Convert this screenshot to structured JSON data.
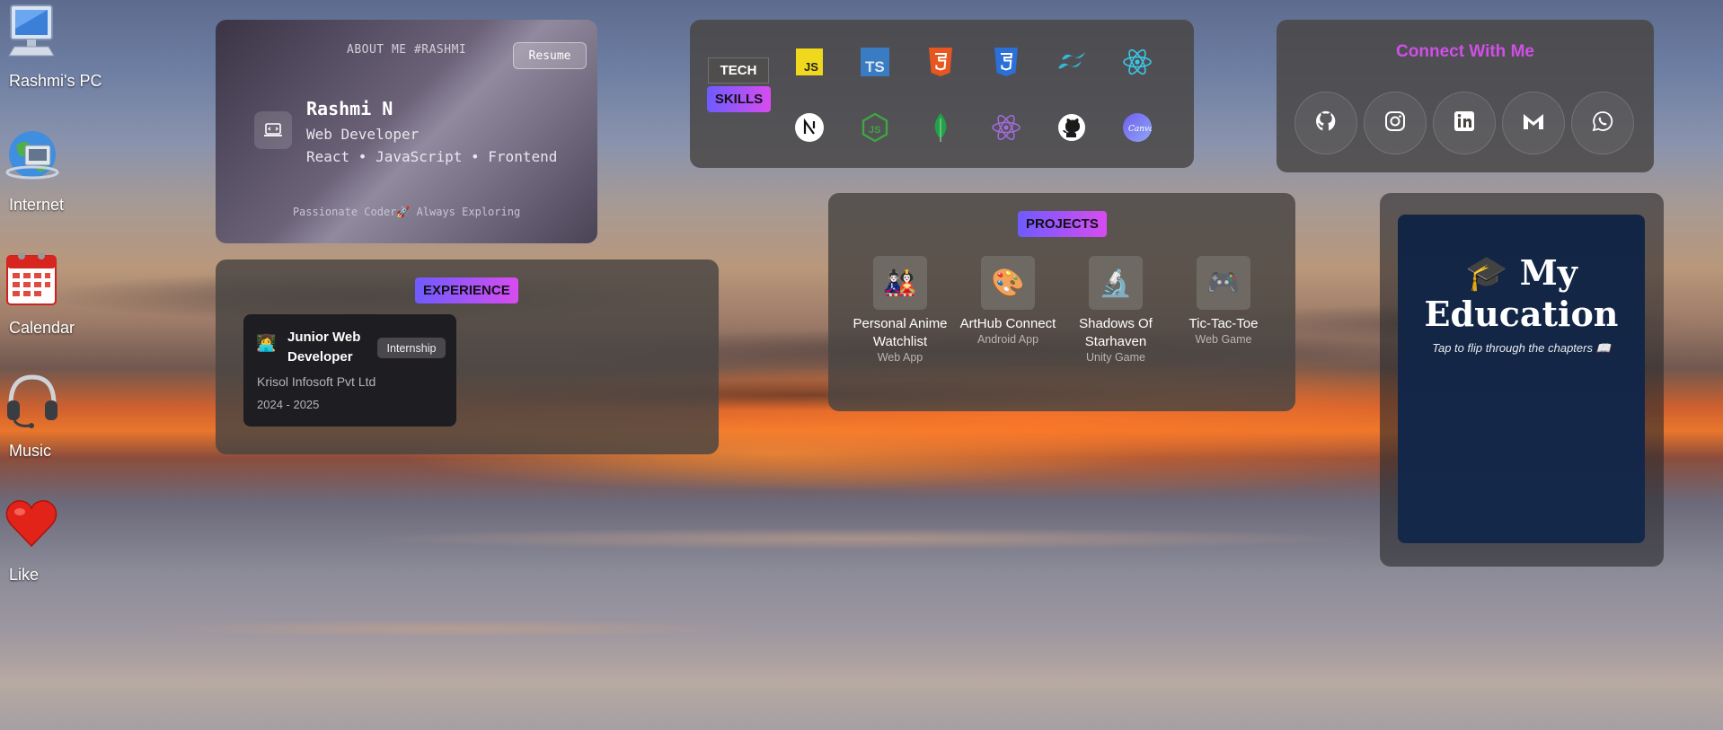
{
  "desktop": {
    "icons": [
      {
        "label": "Rashmi's PC",
        "icon": "computer-icon"
      },
      {
        "label": "Internet",
        "icon": "globe-icon"
      },
      {
        "label": "Calendar",
        "icon": "calendar-icon"
      },
      {
        "label": "Music",
        "icon": "headphones-icon"
      },
      {
        "label": "Like",
        "icon": "heart-icon"
      }
    ]
  },
  "about": {
    "kicker": "ABOUT ME #RASHMI",
    "resume_label": "Resume",
    "name": "Rashmi N",
    "role": "Web Developer",
    "stack": "React • JavaScript • Frontend",
    "tagline": "Passionate Coder🚀 Always Exploring"
  },
  "experience": {
    "heading": "EXPERIENCE",
    "card": {
      "emoji": "👩‍💻",
      "title": "Junior Web Developer",
      "badge": "Internship",
      "company": "Krisol Infosoft Pvt Ltd",
      "dates": "2024 - 2025"
    }
  },
  "tech": {
    "label_top": "TECH",
    "label_bottom": "SKILLS",
    "icons": [
      "javascript-icon",
      "typescript-icon",
      "html5-icon",
      "css3-icon",
      "tailwind-icon",
      "react-icon",
      "nextjs-icon",
      "nodejs-icon",
      "mongodb-icon",
      "react-native-icon",
      "github-icon",
      "canva-icon"
    ]
  },
  "connect": {
    "heading": "Connect With Me",
    "links": [
      "github-icon",
      "instagram-icon",
      "linkedin-icon",
      "gmail-icon",
      "whatsapp-icon"
    ]
  },
  "projects": {
    "heading": "PROJECTS",
    "items": [
      {
        "name": "Personal Anime Watchlist",
        "type": "Web App",
        "emoji": "🎎"
      },
      {
        "name": "ArtHub Connect",
        "type": "Android App",
        "emoji": "🎨"
      },
      {
        "name": "Shadows Of Starhaven",
        "type": "Unity Game",
        "emoji": "🔬"
      },
      {
        "name": "Tic-Tac-Toe",
        "type": "Web Game",
        "emoji": "🎮"
      }
    ]
  },
  "education": {
    "title": "🎓 My Education",
    "subtitle": "Tap to flip through the chapters 📖"
  },
  "colors": {
    "accent_gradient_start": "#6e5bff",
    "accent_gradient_end": "#d84cf0",
    "connect_heading": "#d04fe6",
    "education_card": "#132544"
  }
}
